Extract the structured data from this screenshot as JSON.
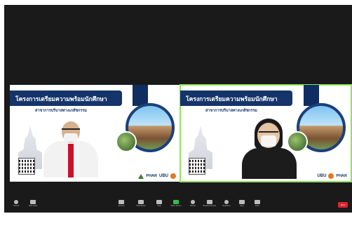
{
  "slide": {
    "title": "โครงการเตรียมความพร้อมนักศึกษา",
    "subtitle": "สาขาการบริบาลทางเภสัชกรรม",
    "logo_text_1": "PHAR",
    "logo_text_2": "UBU"
  },
  "tiles": [
    {
      "id": "tile-1",
      "active_speaker": false
    },
    {
      "id": "tile-2",
      "active_speaker": true
    }
  ],
  "toolbar": {
    "items": [
      {
        "label": "Unmute",
        "icon": "microphone-icon"
      },
      {
        "label": "Start Video",
        "icon": "video-camera-icon"
      },
      {
        "label": "Security",
        "icon": "shield-icon"
      },
      {
        "label": "Participants",
        "icon": "participants-icon"
      },
      {
        "label": "Chat",
        "icon": "chat-icon"
      },
      {
        "label": "Share Screen",
        "icon": "share-screen-icon"
      },
      {
        "label": "Record",
        "icon": "record-icon"
      },
      {
        "label": "Breakout Rooms",
        "icon": "breakout-rooms-icon"
      },
      {
        "label": "Reactions",
        "icon": "reactions-icon"
      },
      {
        "label": "Apps",
        "icon": "apps-icon"
      },
      {
        "label": "More",
        "icon": "more-icon"
      }
    ],
    "end_label": "End"
  },
  "colors": {
    "background": "#1a1a1a",
    "active_speaker_border": "#8fe35a",
    "banner": "#15346a",
    "end_button": "#e0242f",
    "share_screen_icon": "#2fbf4f"
  }
}
